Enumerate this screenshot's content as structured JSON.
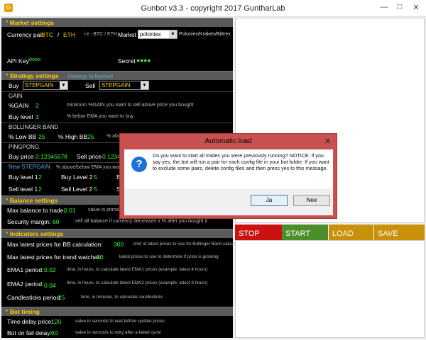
{
  "window": {
    "title": "Gunbot v3.3 - copyright 2017 GuntharLab",
    "minimize": "—",
    "maximize": "□",
    "close": "✕"
  },
  "market": {
    "header": "Market settings",
    "pair_label": "Currency pair",
    "pair_base": "BTC",
    "pair_sep": "/",
    "pair_quote": "ETH",
    "pair_hint": "i.e.: BTC / ETH",
    "market_label": "Market",
    "market_value": "poloniex",
    "market_hint": "Poloniex/Kraken/Bittrex",
    "apikey_label": "API Key",
    "apikey_value": "xxxxx",
    "secret_label": "Secret",
    "secret_value": "●●●●"
  },
  "strategy": {
    "header": "Strategy settings",
    "header_hint": "Strategy to buy/sell",
    "buy_label": "Buy",
    "buy_value": "STEPGAIN",
    "sell_label": "Sell",
    "sell_value": "STEPGAIN",
    "gain_title": "GAIN",
    "pct_gain_label": "%GAIN",
    "pct_gain_value": "2",
    "pct_gain_hint": "minimum %GAIN you want to sell above price you bought",
    "buy_level_label": "Buy level",
    "buy_level_value": "3",
    "buy_level_hint": "% below EMA you want to buy",
    "bb_title": "BOLLINGER BAND",
    "low_bb_label": "% Low BB",
    "low_bb_value": "25",
    "high_bb_label": "% High BB",
    "high_bb_value": "25",
    "bb_hint": "% above",
    "pp_title": "PINGPONG",
    "pp_buy_label": "Buy price",
    "pp_buy_value": "0.12345678",
    "pp_sell_label": "Sell price",
    "pp_sell_value": "0.1234",
    "step_title": "New STEPGAIN",
    "step_hint": "% above/below EMA you want to",
    "buy_level1_label": "Buy level 1",
    "buy_level1_value": "2",
    "buy_level2_label": "Buy Level 2",
    "buy_level2_value": "5",
    "buy_level3_label": "B",
    "sell_level1_label": "Sell level 1",
    "sell_level1_value": "2",
    "sell_level2_label": "Sell Level 2",
    "sell_level2_value": "5",
    "sell_level3_label": "S"
  },
  "balance": {
    "header": "Balance settings",
    "max_label": "Max balance to trade:",
    "max_value": "0.01",
    "max_hint": "value in primar",
    "margin_label": "Security margin:",
    "margin_value": "60",
    "margin_hint": "sell all balance if currency decreases x % after you bought it"
  },
  "indicators": {
    "header": "Indicators settings",
    "bb_calc_label": "Max latest prices for BB calculation:",
    "bb_calc_value": "300",
    "bb_calc_hint": "limit of latest prices to use for Bollinger Band calculation",
    "trend_label": "Max latest prices for trend watcher:",
    "trend_value": "30",
    "trend_hint": "latest prices to use to determine if price is growing",
    "ema1_label": "EMA1 period:",
    "ema1_value": "0.02",
    "ema1_hint": "time, in hours, to calculate latest EMA1 prices (example: latest 4 hours)",
    "ema2_label": "EMA2 period:",
    "ema2_value": "0.04",
    "ema2_hint": "time, in hours, to calculate latest EMA2 prices (example: latest 8 hours)",
    "candles_label": "Candlesticks period:",
    "candles_value": "15",
    "candles_hint": "time, in minutes, to calculate candlesticks"
  },
  "bot_timing": {
    "header": "Bot timing",
    "delay_label": "Time delay price:",
    "delay_value": "120",
    "delay_hint": "value in seconds to wait before update prices",
    "fail_label": "Bot on fail delay:",
    "fail_value": "60",
    "fail_hint": "value in seconds to retry after a failed cycle"
  },
  "actions": {
    "stop": "STOP",
    "start": "START",
    "load": "LOAD",
    "save": "SAVE"
  },
  "colors": {
    "stop": "#cc1111",
    "start": "#4a8f2a",
    "load": "#c9900a",
    "save": "#c9900a"
  },
  "dialog": {
    "title": "Automatic load",
    "close": "✕",
    "message": "Do you want to start all trades you were previously running? NOTICE: if you say yes, the bot will run a pair for each config file in your bot folder. If you want to exclude some pairs, delete config files and then press yes to this message.",
    "yes": "Ja",
    "no": "Nee",
    "icon": "question-icon"
  }
}
